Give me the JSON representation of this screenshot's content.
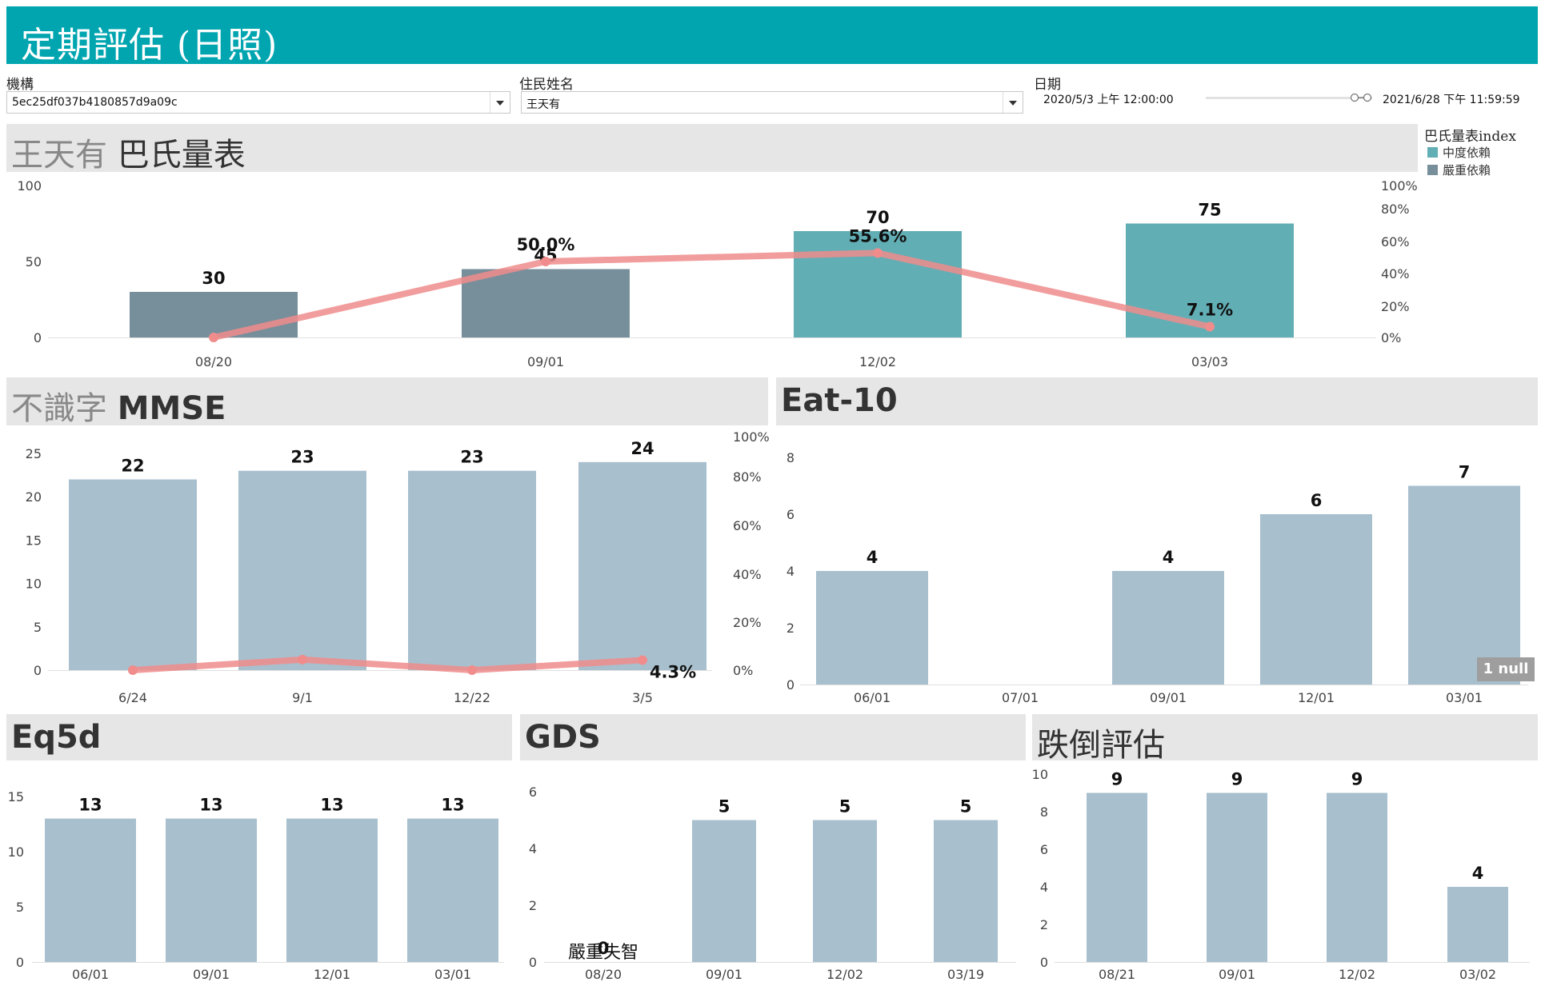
{
  "header": {
    "title": "定期評估 (日照)"
  },
  "filters": {
    "org_label": "機構",
    "org_value": "5ec25df037b4180857d9a09c",
    "resident_label": "住民姓名",
    "resident_value": "王天有",
    "date_label": "日期",
    "date_start": "2020/5/3 上午 12:00:00",
    "date_end": "2021/6/28 下午 11:59:59"
  },
  "legend": {
    "title": "巴氏量表index",
    "items": [
      {
        "label": "中度依賴",
        "color": "#62aeb5"
      },
      {
        "label": "嚴重依賴",
        "color": "#778f9b"
      }
    ]
  },
  "colors": {
    "bar": "#a8c0ce",
    "line": "#f08c8c",
    "moderate": "#62aeb5",
    "severe": "#778f9b"
  },
  "panels": {
    "barthel": {
      "title_light": "王天有",
      "title_dark": "巴氏量表"
    },
    "mmse": {
      "title_light": "不識字",
      "title_dark": "MMSE"
    },
    "eat10": {
      "title": "Eat-10",
      "null_badge": "1 null"
    },
    "eq5d": {
      "title": "Eq5d"
    },
    "gds": {
      "title": "GDS"
    },
    "fall": {
      "title": "跌倒評估"
    }
  },
  "chart_data": [
    {
      "id": "barthel",
      "type": "bar",
      "categories": [
        "08/20",
        "09/01",
        "12/02",
        "03/03"
      ],
      "values": [
        30,
        45,
        70,
        75
      ],
      "value_labels": [
        "30",
        "45",
        "70",
        "75"
      ],
      "bar_index": [
        "嚴重依賴",
        "嚴重依賴",
        "中度依賴",
        "中度依賴"
      ],
      "ylim": [
        0,
        100
      ],
      "yticks": [
        "0",
        "50",
        "100"
      ],
      "line": {
        "values": [
          0,
          50.0,
          55.6,
          7.1
        ],
        "labels": [
          "",
          "50.0%",
          "55.6%",
          "7.1%"
        ]
      },
      "y2lim": [
        0,
        100
      ],
      "y2ticks": [
        "0%",
        "20%",
        "40%",
        "60%",
        "80%",
        "100%"
      ]
    },
    {
      "id": "mmse",
      "type": "bar",
      "categories": [
        "6/24",
        "9/1",
        "12/22",
        "3/5"
      ],
      "values": [
        22,
        23,
        23,
        24
      ],
      "value_labels": [
        "22",
        "23",
        "23",
        "24"
      ],
      "ylim": [
        0,
        25
      ],
      "yticks": [
        "0",
        "5",
        "10",
        "15",
        "20",
        "25"
      ],
      "line": {
        "values": [
          0,
          4.5,
          0,
          4.3
        ],
        "labels": [
          "",
          "",
          "",
          "4.3%"
        ]
      },
      "y2lim": [
        0,
        100
      ],
      "y2ticks": [
        "0%",
        "20%",
        "40%",
        "60%",
        "80%",
        "100%"
      ]
    },
    {
      "id": "eat10",
      "type": "bar",
      "categories": [
        "06/01",
        "07/01",
        "09/01",
        "12/01",
        "03/01"
      ],
      "values": [
        4,
        null,
        4,
        6,
        7
      ],
      "value_labels": [
        "4",
        "",
        "4",
        "6",
        "7"
      ],
      "ylim": [
        0,
        8
      ],
      "yticks": [
        "0",
        "2",
        "4",
        "6",
        "8"
      ]
    },
    {
      "id": "eq5d",
      "type": "bar",
      "categories": [
        "06/01",
        "09/01",
        "12/01",
        "03/01"
      ],
      "values": [
        13,
        13,
        13,
        13
      ],
      "value_labels": [
        "13",
        "13",
        "13",
        "13"
      ],
      "ylim": [
        0,
        15
      ],
      "yticks": [
        "0",
        "5",
        "10",
        "15"
      ]
    },
    {
      "id": "gds",
      "type": "bar",
      "categories": [
        "08/20",
        "09/01",
        "12/02",
        "03/19"
      ],
      "values": [
        0,
        5,
        5,
        5
      ],
      "value_labels": [
        "0",
        "5",
        "5",
        "5"
      ],
      "annotation": "嚴重失智",
      "ylim": [
        0,
        6
      ],
      "yticks": [
        "0",
        "2",
        "4",
        "6"
      ]
    },
    {
      "id": "fall",
      "type": "bar",
      "categories": [
        "08/21",
        "09/01",
        "12/02",
        "03/02"
      ],
      "values": [
        9,
        9,
        9,
        4
      ],
      "value_labels": [
        "9",
        "9",
        "9",
        "4"
      ],
      "ylim": [
        0,
        10
      ],
      "yticks": [
        "0",
        "2",
        "4",
        "6",
        "8",
        "10"
      ]
    }
  ]
}
